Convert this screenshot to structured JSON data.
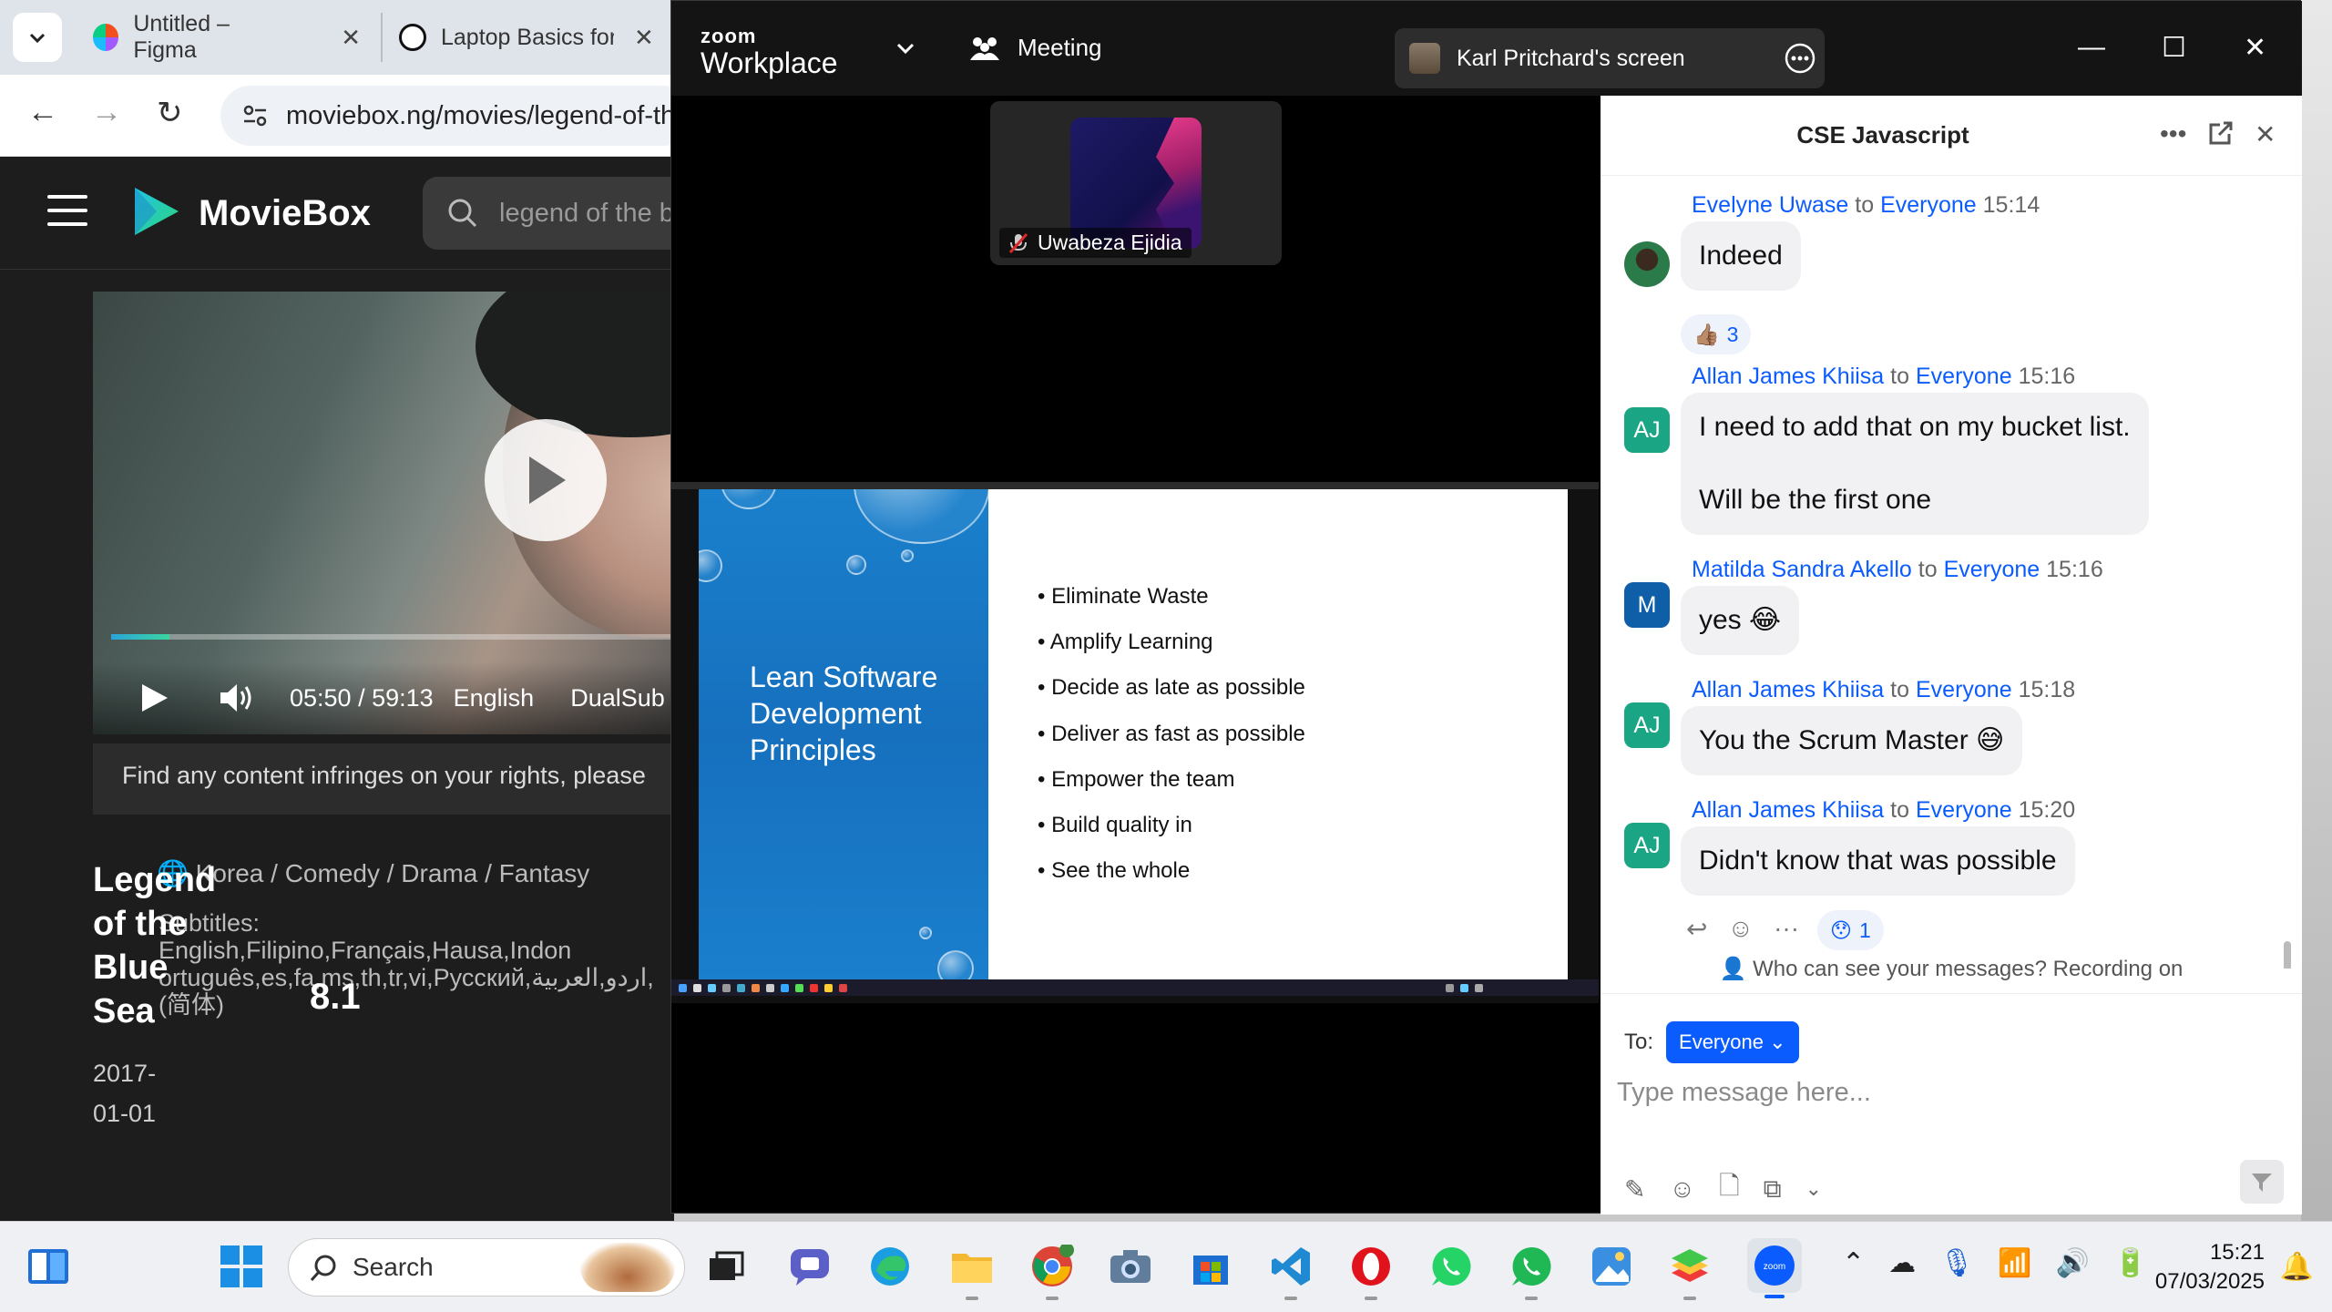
{
  "browser": {
    "tabs": [
      {
        "label": "Untitled – Figma",
        "icon": "figma-icon"
      },
      {
        "label": "Laptop Basics for E",
        "icon": "chatgpt-icon"
      }
    ],
    "url": "moviebox.ng/movies/legend-of-th"
  },
  "moviebox": {
    "name": "MovieBox",
    "search_value": "legend of the b",
    "player": {
      "time": "05:50 / 59:13",
      "language": "English",
      "subs": "DualSub",
      "progress": 0.1
    },
    "notice": "Find any content infringes on your rights, please",
    "title": "Legend of the Blue Sea",
    "genres": "Korea / Comedy / Drama / Fantasy",
    "subtitles": "Subtitles: English,Filipino,Français,Hausa,Indon ortuguês,es,fa,ms,th,tr,vi,Русский,اردو,العربية, (简体)",
    "rating": "8.1",
    "date": "2017-01-01"
  },
  "zoom": {
    "brand_small": "zoom",
    "brand_big": "Workplace",
    "meeting_label": "Meeting",
    "share_label": "Karl Pritchard's screen",
    "participant": "Uwabeza Ejidia",
    "slide": {
      "title": "Lean Software Development Principles",
      "bullets": [
        "Eliminate Waste",
        "Amplify Learning",
        "Decide as late as possible",
        "Deliver as fast as possible",
        "Empower the team",
        "Build quality in",
        "See the whole"
      ]
    },
    "chat": {
      "title": "CSE Javascript",
      "messages": [
        {
          "sender": "Evelyne Uwase",
          "to": "to",
          "recipient": "Everyone",
          "time": "15:14",
          "text": "Indeed",
          "avatar": "",
          "reaction": "3"
        },
        {
          "sender": "Allan James Khiisa",
          "to": "to",
          "recipient": "Everyone",
          "time": "15:16",
          "text": "I need to add that on my bucket list.",
          "text2": "Will be the first one",
          "avatar": "AJ"
        },
        {
          "sender": "Matilda Sandra Akello",
          "to": "to",
          "recipient": "Everyone",
          "time": "15:16",
          "text": "yes 😂",
          "avatar": "M"
        },
        {
          "sender": "Allan James Khiisa",
          "to": "to",
          "recipient": "Everyone",
          "time": "15:18",
          "text": "You the Scrum Master 😅",
          "avatar": "AJ"
        },
        {
          "sender": "Allan James Khiisa",
          "to": "to",
          "recipient": "Everyone",
          "time": "15:20",
          "text": "Didn't know that was possible",
          "avatar": "AJ",
          "reaction": "1"
        }
      ],
      "visibility_note": "Who can see your messages? Recording on",
      "to_label": "To:",
      "to_value": "Everyone",
      "input_placeholder": "Type message here..."
    }
  },
  "taskbar": {
    "search_label": "Search",
    "time": "15:21",
    "date": "07/03/2025"
  },
  "colors": {
    "zoom_blue": "#0b5cff",
    "aj_avatar": "#1aa584",
    "m_avatar": "#0e5fa8",
    "slide_blue": "#1a7fcd"
  }
}
